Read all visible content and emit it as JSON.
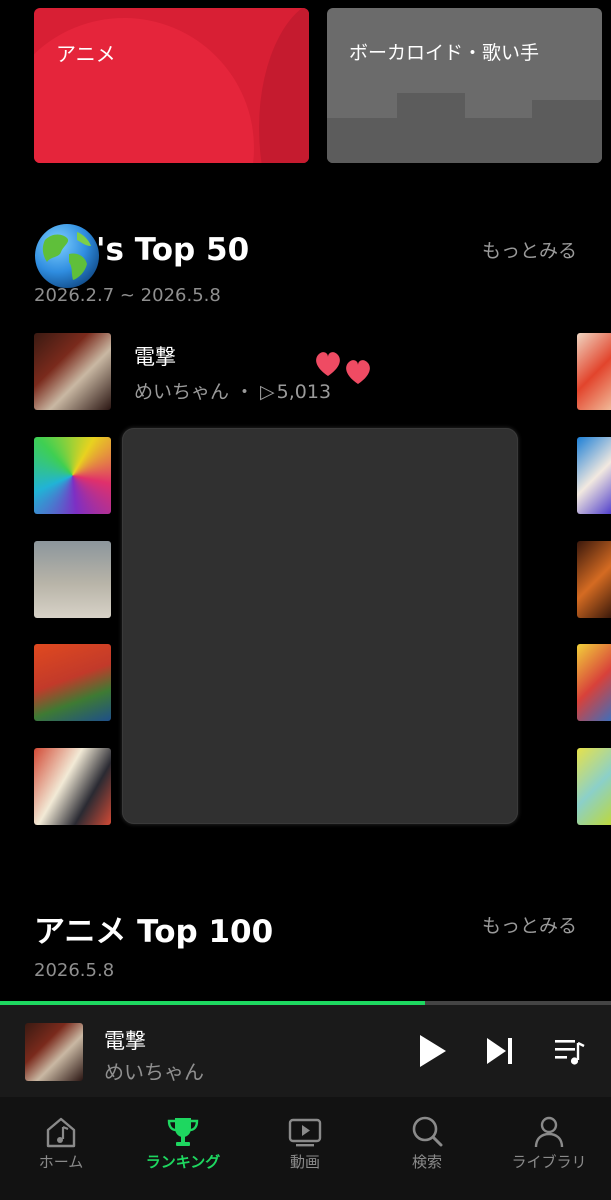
{
  "genres": [
    {
      "label": "アニメ",
      "color": "#d81f34"
    },
    {
      "label": "ボーカロイド・歌い手",
      "color": "#6b6b6b"
    }
  ],
  "world_section": {
    "title_visible": "'s Top 50",
    "date_range": "2026.2.7 ~ 2026.5.8",
    "more_label": "もっとみる",
    "icon": "globe-icon"
  },
  "track_first": {
    "title": "電撃",
    "artist": "めいちゃん",
    "separator": "・",
    "play_icon": "▷",
    "play_count": "5,013"
  },
  "anime_section": {
    "title": "アニメ Top 100",
    "date": "2026.5.8",
    "more_label": "もっとみる"
  },
  "now_playing": {
    "title": "電撃",
    "artist": "めいちゃん",
    "progress": 0.695,
    "accent": "#1ed760"
  },
  "nav": [
    {
      "label": "ホーム",
      "icon": "home-music-icon",
      "active": false
    },
    {
      "label": "ランキング",
      "icon": "trophy-icon",
      "active": true
    },
    {
      "label": "動画",
      "icon": "video-icon",
      "active": false
    },
    {
      "label": "検索",
      "icon": "search-icon",
      "active": false
    },
    {
      "label": "ライブラリ",
      "icon": "profile-icon",
      "active": false
    }
  ]
}
